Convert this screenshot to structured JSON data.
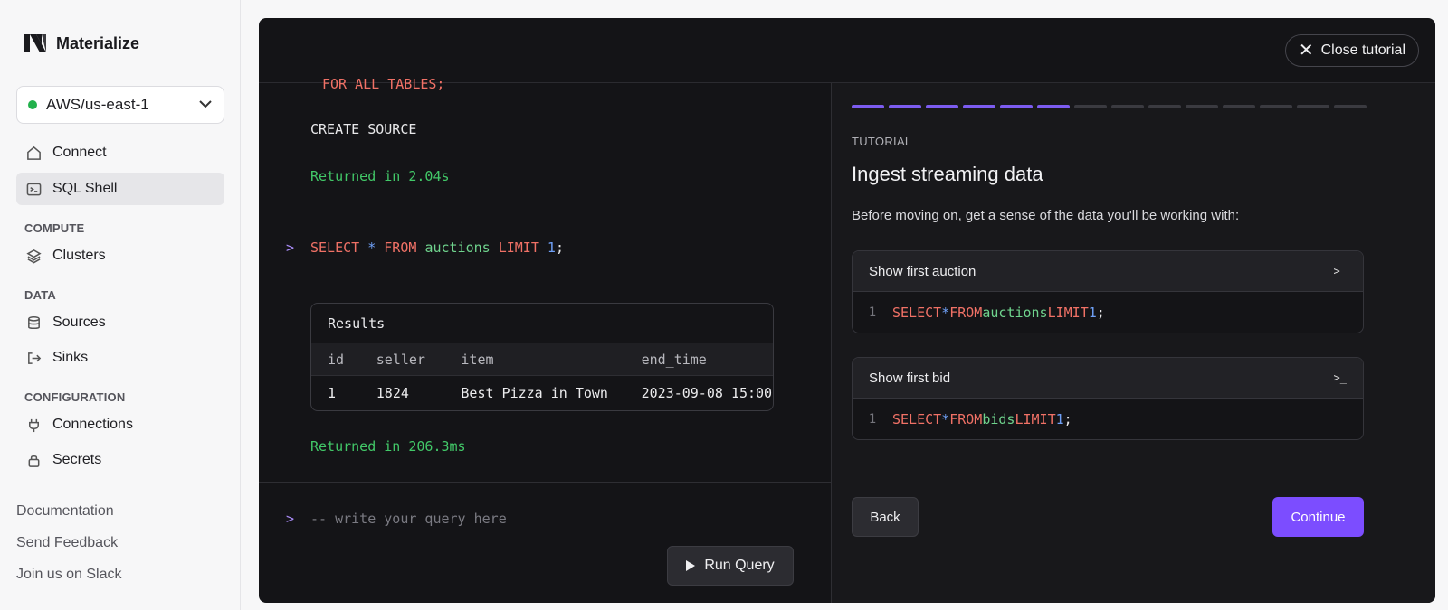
{
  "app": {
    "name": "Materialize"
  },
  "region": {
    "label": "AWS/us-east-1",
    "status_color": "#22b14c"
  },
  "nav": {
    "connect": "Connect",
    "sql_shell": "SQL Shell",
    "compute_head": "COMPUTE",
    "clusters": "Clusters",
    "data_head": "DATA",
    "sources": "Sources",
    "sinks": "Sinks",
    "config_head": "CONFIGURATION",
    "connections": "Connections",
    "secrets": "Secrets"
  },
  "footer": {
    "documentation": "Documentation",
    "feedback": "Send Feedback",
    "slack": "Join us on Slack"
  },
  "topbar": {
    "close_label": "Close tutorial"
  },
  "shell": {
    "partial_line": "FOR ALL TABLES;",
    "create_source": "CREATE SOURCE",
    "returned_1": "Returned in 2.04s",
    "query": {
      "kw1": "SELECT",
      "star": "*",
      "kw2": "FROM",
      "table": "auctions",
      "kw3": "LIMIT",
      "num": "1",
      "end": ";"
    },
    "results": {
      "title": "Results",
      "columns": [
        "id",
        "seller",
        "item",
        "end_time"
      ],
      "rows": [
        [
          "1",
          "1824",
          "Best Pizza in Town",
          "2023-09-08 15:00"
        ]
      ]
    },
    "returned_2": "Returned in 206.3ms",
    "input_placeholder": "-- write your query here",
    "run_label": "Run Query"
  },
  "tutorial": {
    "progress": {
      "completed": 6,
      "total": 14
    },
    "label": "TUTORIAL",
    "title": "Ingest streaming data",
    "description": "Before moving on, get a sense of the data you'll be working with:",
    "cards": [
      {
        "title": "Show first auction",
        "line": "1",
        "kw1": "SELECT",
        "star": "*",
        "kw2": "FROM",
        "table": "auctions",
        "kw3": "LIMIT",
        "num": "1",
        "end": ";"
      },
      {
        "title": "Show first bid",
        "line": "1",
        "kw1": "SELECT",
        "star": "*",
        "kw2": "FROM",
        "table": "bids",
        "kw3": "LIMIT",
        "num": "1",
        "end": ";"
      }
    ],
    "back_label": "Back",
    "continue_label": "Continue",
    "accent_color": "#7c4dff"
  }
}
